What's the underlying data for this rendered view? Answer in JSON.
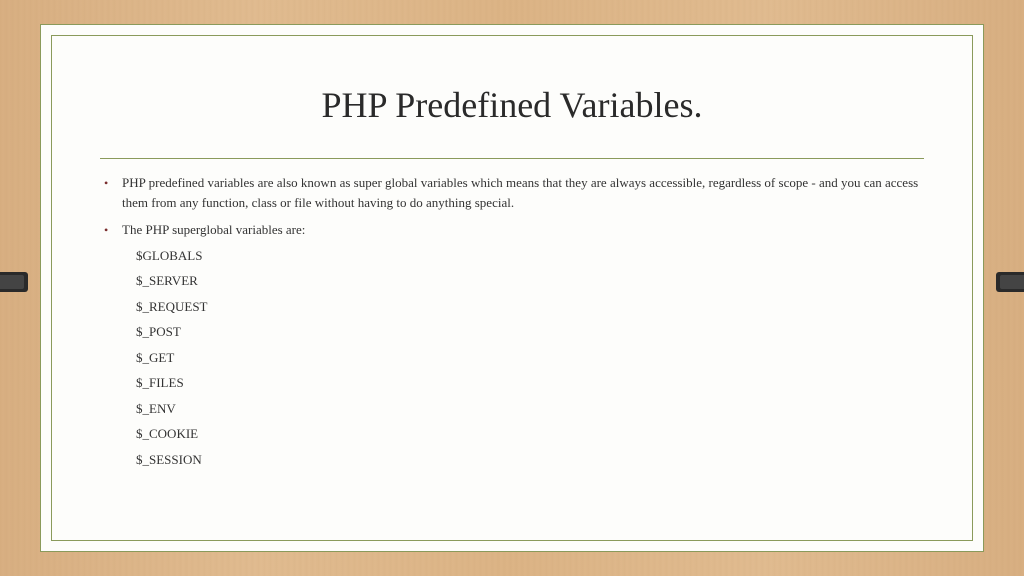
{
  "title": "PHP Predefined Variables.",
  "bullets": [
    {
      "text": "PHP predefined variables are also known as super global variables which means that they are always accessible, regardless of scope - and you can access them from any function, class or file without having to do anything special."
    },
    {
      "text": "The PHP superglobal variables are:",
      "sub": [
        "$GLOBALS",
        "$_SERVER",
        "$_REQUEST",
        "$_POST",
        "$_GET",
        "$_FILES",
        "$_ENV",
        "$_COOKIE",
        "$_SESSION"
      ]
    }
  ]
}
